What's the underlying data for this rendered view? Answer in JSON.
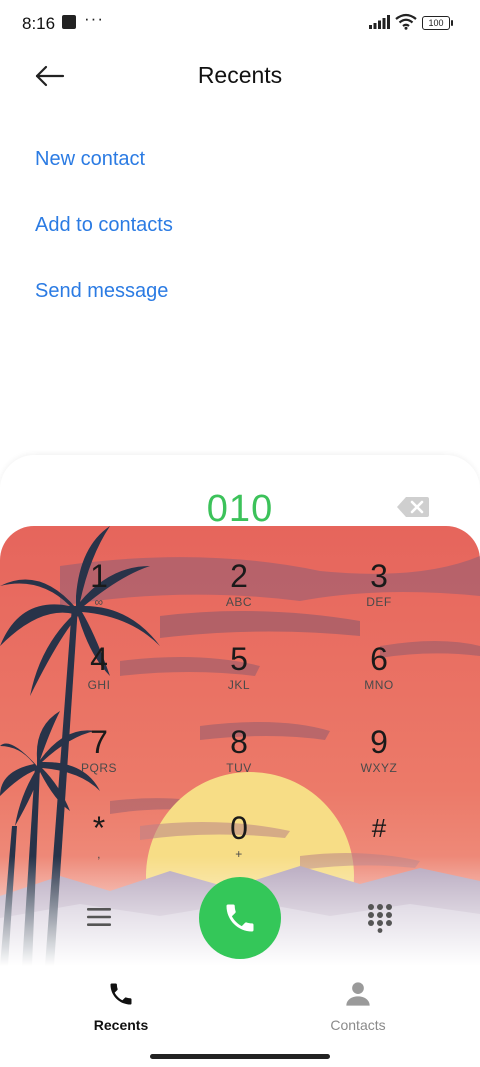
{
  "status_bar": {
    "time": "8:16",
    "dots": "···",
    "battery": "100"
  },
  "header": {
    "title": "Recents",
    "back_icon": "arrow-left-icon"
  },
  "actions": [
    {
      "label": "New contact"
    },
    {
      "label": "Add to contacts"
    },
    {
      "label": "Send message"
    }
  ],
  "dialer": {
    "number": "010",
    "keys": [
      {
        "digit": "1",
        "letters": "∞"
      },
      {
        "digit": "2",
        "letters": "ABC"
      },
      {
        "digit": "3",
        "letters": "DEF"
      },
      {
        "digit": "4",
        "letters": "GHI"
      },
      {
        "digit": "5",
        "letters": "JKL"
      },
      {
        "digit": "6",
        "letters": "MNO"
      },
      {
        "digit": "7",
        "letters": "PQRS"
      },
      {
        "digit": "8",
        "letters": "TUV"
      },
      {
        "digit": "9",
        "letters": "WXYZ"
      },
      {
        "digit": "*",
        "letters": ","
      },
      {
        "digit": "0",
        "letters": "+"
      },
      {
        "digit": "#",
        "letters": ""
      }
    ]
  },
  "bottom_nav": {
    "items": [
      {
        "label": "Recents",
        "icon": "phone-icon",
        "active": true
      },
      {
        "label": "Contacts",
        "icon": "person-icon",
        "active": false
      }
    ]
  },
  "colors": {
    "accent_blue": "#2b7be3",
    "dial_green": "#3cc25a",
    "call_green": "#34c759",
    "sky_red": "#e8675e"
  }
}
